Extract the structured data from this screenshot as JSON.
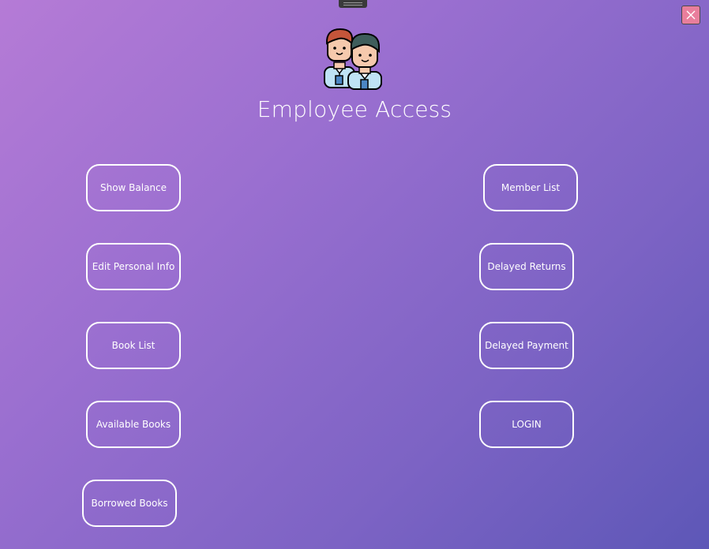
{
  "window": {
    "close_icon": "close-icon",
    "accent_color": "#e97e9c"
  },
  "header": {
    "title": "Employee Access",
    "avatar_icon": "employees-icon"
  },
  "buttons": {
    "show_balance": "Show Balance",
    "edit_personal_info": "Edit Personal Info",
    "book_list": "Book List",
    "available_books": "Available Books",
    "borrowed_books": "Borrowed Books",
    "member_list": "Member List",
    "delayed_returns": "Delayed Returns",
    "delayed_payment": "Delayed Payment",
    "login": "LOGIN"
  },
  "colors": {
    "gradient_start": "#b57bd6",
    "gradient_end": "#5d57b7",
    "button_border": "#ffffff",
    "text": "#ffffff"
  }
}
